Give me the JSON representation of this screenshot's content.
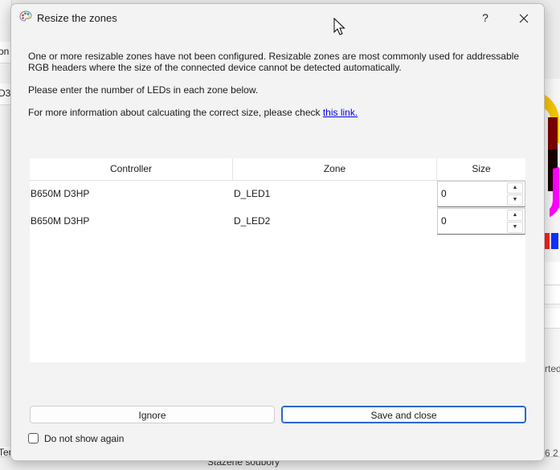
{
  "background": {
    "left_rows": [
      "on",
      "D3"
    ],
    "bottom_status": "Stažené soubory",
    "right_snippets": [
      "6 2",
      "rted"
    ],
    "left_bottom": "Ter"
  },
  "dialog": {
    "title": "Resize the zones",
    "help_label": "?",
    "message_1": "One or more resizable zones have not been configured. Resizable zones are most commonly used for addressable RGB headers where the size of the connected device cannot be detected automatically.",
    "message_2": "Please enter the number of LEDs in each zone below.",
    "message_3_prefix": "For more information about calcuating the correct size, please check ",
    "message_3_link": "this link.",
    "table": {
      "columns": {
        "controller": "Controller",
        "zone": "Zone",
        "size": "Size"
      },
      "rows": [
        {
          "controller": "B650M D3HP",
          "zone": "D_LED1",
          "size": "0"
        },
        {
          "controller": "B650M D3HP",
          "zone": "D_LED2",
          "size": "0"
        }
      ]
    },
    "ignore_label": "Ignore",
    "save_label": "Save and close",
    "dont_show_label": "Do not show again",
    "dont_show_checked": false
  }
}
